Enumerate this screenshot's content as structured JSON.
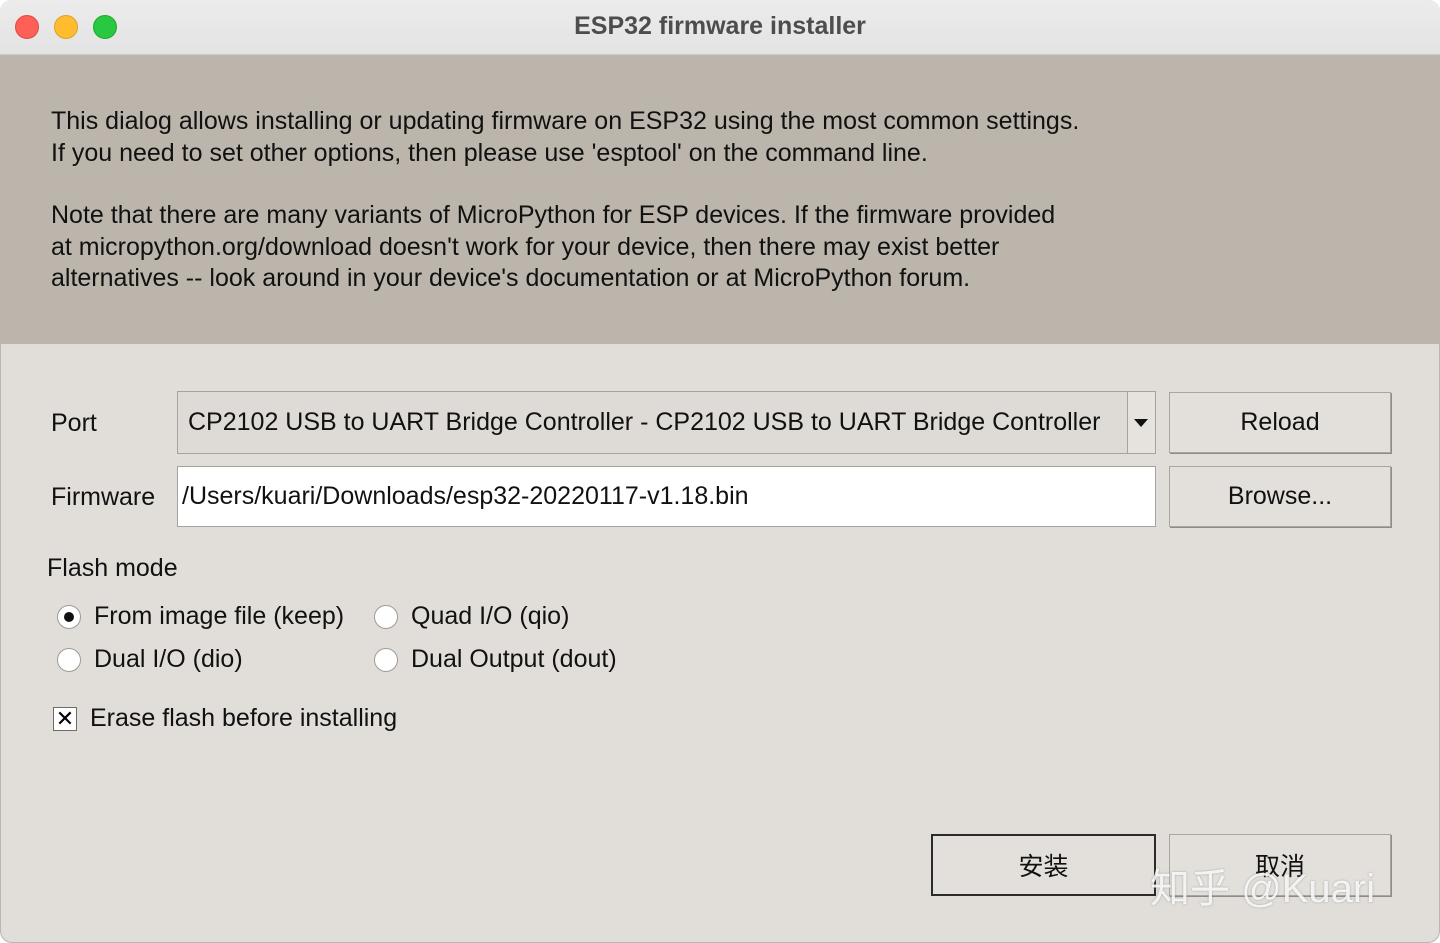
{
  "window": {
    "title": "ESP32 firmware installer"
  },
  "intro": {
    "paragraph1": "This dialog allows installing or updating firmware on ESP32 using the most common settings.\nIf you need to set other options, then please use 'esptool' on the command line.",
    "paragraph2": "Note that there are many variants of MicroPython for ESP devices. If the firmware provided\nat micropython.org/download doesn't work for your device, then there may exist better\nalternatives -- look around in your device's documentation or at MicroPython forum."
  },
  "port": {
    "label": "Port",
    "selected": "CP2102 USB to UART Bridge Controller - CP2102 USB to UART Bridge Controller",
    "reload_label": "Reload"
  },
  "firmware": {
    "label": "Firmware",
    "value": "/Users/kuari/Downloads/esp32-20220117-v1.18.bin",
    "browse_label": "Browse..."
  },
  "flash_mode": {
    "label": "Flash mode",
    "options": [
      {
        "label": "From image file (keep)",
        "checked": true
      },
      {
        "label": "Quad I/O (qio)",
        "checked": false
      },
      {
        "label": "Dual I/O (dio)",
        "checked": false
      },
      {
        "label": "Dual Output (dout)",
        "checked": false
      }
    ]
  },
  "erase": {
    "label": "Erase flash before installing",
    "checked": true,
    "mark": "✕"
  },
  "actions": {
    "install_label": "安装",
    "cancel_label": "取消"
  },
  "watermark": {
    "text": "知乎 @Kuari"
  },
  "colors": {
    "intro_background": "#bbb5ab",
    "dialog_background": "#e1deda",
    "close": "#fe5f57",
    "minimize": "#febc2e",
    "zoom": "#28c840"
  }
}
